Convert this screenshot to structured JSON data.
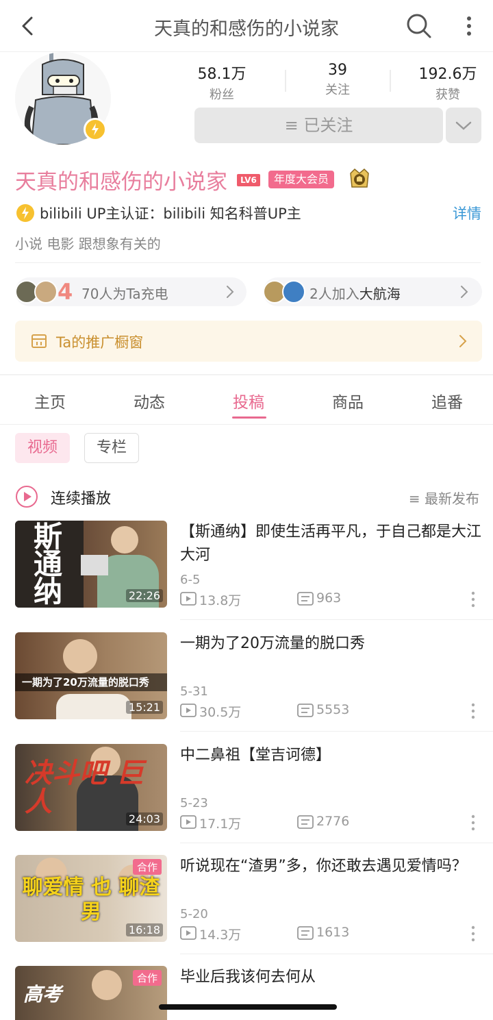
{
  "header": {
    "title": "天真的和感伤的小说家"
  },
  "stats": [
    {
      "value": "58.1万",
      "label": "粉丝"
    },
    {
      "value": "39",
      "label": "关注"
    },
    {
      "value": "192.6万",
      "label": "获赞"
    }
  ],
  "follow": {
    "label": "≡ 已关注"
  },
  "profile": {
    "name": "天真的和感伤的小说家",
    "level": "LV6",
    "vip_label": "年度大会员",
    "verify_text": "bilibili  UP主认证：bilibili  知名科普UP主",
    "detail_link": "详情",
    "tags": "小说  电影  跟想象有关的"
  },
  "charge": {
    "count": "4",
    "text": "70人为Ta充电"
  },
  "fleet": {
    "prefix": "2人加入",
    "name": "大航海"
  },
  "shop": {
    "label": "Ta的推广橱窗"
  },
  "tabs": [
    {
      "label": "主页"
    },
    {
      "label": "动态"
    },
    {
      "label": "投稿"
    },
    {
      "label": "商品"
    },
    {
      "label": "追番"
    }
  ],
  "subtabs": {
    "video": "视频",
    "column": "专栏"
  },
  "playlist": {
    "play_all": "连续播放",
    "sort": "≡ 最新发布"
  },
  "colors": {
    "accent": "#e8698f",
    "link": "#3a98d6",
    "shop": "#c98f2e"
  },
  "videos": [
    {
      "title": "【斯通纳】即使生活再平凡，于自己都是大江大河",
      "date": "6-5",
      "views": "13.8万",
      "danmaku": "963",
      "duration": "22:26",
      "thumb_text": "斯通纳"
    },
    {
      "title": "一期为了20万流量的脱口秀",
      "date": "5-31",
      "views": "30.5万",
      "danmaku": "5553",
      "duration": "15:21",
      "thumb_text": "一期为了20万流量的脱口秀"
    },
    {
      "title": "中二鼻祖【堂吉诃德】",
      "date": "5-23",
      "views": "17.1万",
      "danmaku": "2776",
      "duration": "24:03",
      "thumb_text": "决斗吧 巨人"
    },
    {
      "title": "听说现在“渣男”多，你还敢去遇见爱情吗？",
      "date": "5-20",
      "views": "14.3万",
      "danmaku": "1613",
      "duration": "16:18",
      "coop": "合作",
      "thumb_text": "聊爱情 也 聊渣男"
    },
    {
      "title": "毕业后我该何去何从",
      "coop": "合作",
      "thumb_text": "高考"
    }
  ]
}
